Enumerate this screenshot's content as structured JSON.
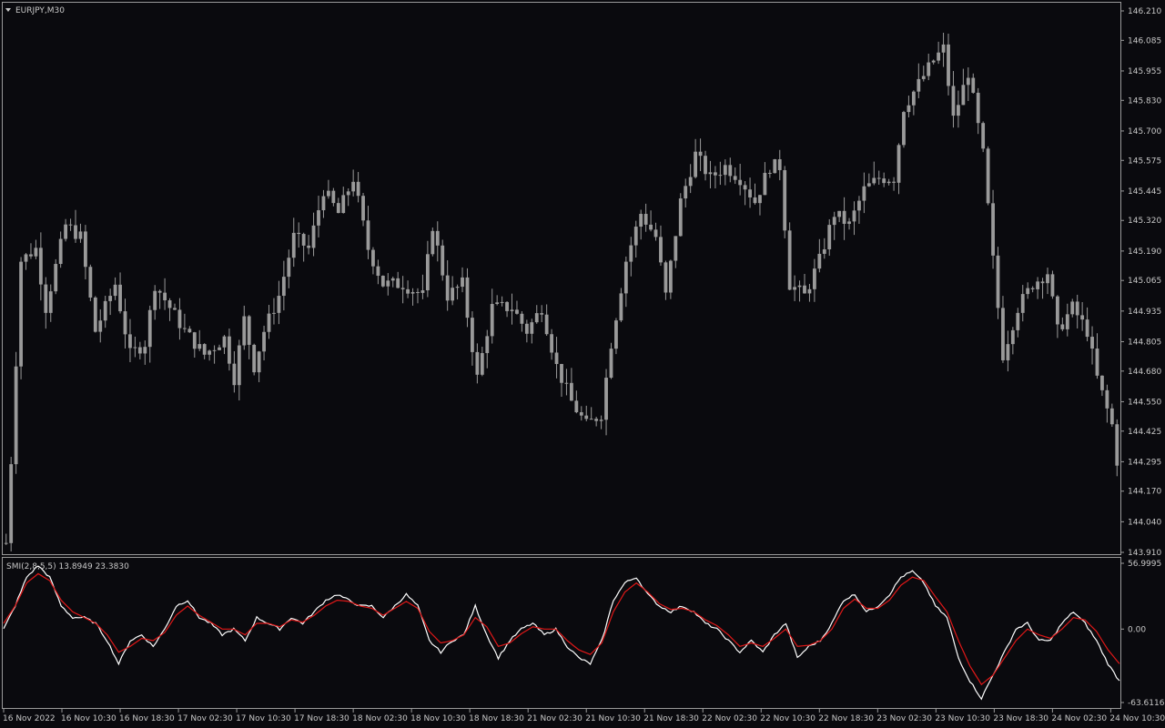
{
  "chart_title": "EURJPY,M30",
  "indicator_label": "SMI(2,8,5,5) 13.8949 23.3830",
  "colors": {
    "background": "#0a0a0e",
    "candle": "#9a9a9a",
    "frame": "#9a9a9a",
    "text": "#c8c8c8",
    "smi_line": "#ffffff",
    "signal_line": "#e01818"
  },
  "icons": {
    "collapse": "triangle-down-icon"
  },
  "chart_data": [
    {
      "type": "candlestick",
      "title": "EURJPY,M30",
      "price_ticks": [
        "146.210",
        "146.085",
        "145.955",
        "145.830",
        "145.700",
        "145.575",
        "145.445",
        "145.320",
        "145.190",
        "145.065",
        "144.935",
        "144.805",
        "144.680",
        "144.550",
        "144.425",
        "144.295",
        "144.170",
        "144.040",
        "143.910"
      ],
      "ylim": [
        143.91,
        146.21
      ],
      "x_ticks": [
        "16 Nov 2022",
        "16 Nov 10:30",
        "16 Nov 18:30",
        "17 Nov 02:30",
        "17 Nov 10:30",
        "17 Nov 18:30",
        "18 Nov 02:30",
        "18 Nov 10:30",
        "18 Nov 18:30",
        "21 Nov 02:30",
        "21 Nov 10:30",
        "21 Nov 18:30",
        "22 Nov 02:30",
        "22 Nov 10:30",
        "22 Nov 18:30",
        "23 Nov 02:30",
        "23 Nov 10:30",
        "23 Nov 18:30",
        "24 Nov 02:30",
        "24 Nov 10:30"
      ],
      "close_anchors": [
        [
          0,
          143.95
        ],
        [
          1,
          144.3
        ],
        [
          3,
          145.15
        ],
        [
          6,
          145.2
        ],
        [
          8,
          144.95
        ],
        [
          12,
          145.3
        ],
        [
          15,
          145.25
        ],
        [
          18,
          144.85
        ],
        [
          22,
          145.05
        ],
        [
          25,
          144.75
        ],
        [
          28,
          144.8
        ],
        [
          30,
          145.05
        ],
        [
          33,
          144.95
        ],
        [
          36,
          144.85
        ],
        [
          40,
          144.75
        ],
        [
          44,
          144.82
        ],
        [
          46,
          144.65
        ],
        [
          48,
          144.9
        ],
        [
          50,
          144.7
        ],
        [
          52,
          144.85
        ],
        [
          55,
          145.0
        ],
        [
          58,
          145.25
        ],
        [
          61,
          145.2
        ],
        [
          64,
          145.45
        ],
        [
          67,
          145.35
        ],
        [
          70,
          145.5
        ],
        [
          73,
          145.2
        ],
        [
          76,
          145.05
        ],
        [
          80,
          145.05
        ],
        [
          84,
          145.0
        ],
        [
          86,
          145.3
        ],
        [
          89,
          145.0
        ],
        [
          92,
          145.05
        ],
        [
          95,
          144.65
        ],
        [
          98,
          144.95
        ],
        [
          102,
          144.95
        ],
        [
          105,
          144.85
        ],
        [
          108,
          144.95
        ],
        [
          111,
          144.7
        ],
        [
          114,
          144.55
        ],
        [
          117,
          144.45
        ],
        [
          120,
          144.5
        ],
        [
          122,
          144.8
        ],
        [
          125,
          145.15
        ],
        [
          128,
          145.35
        ],
        [
          131,
          145.25
        ],
        [
          133,
          145.0
        ],
        [
          136,
          145.4
        ],
        [
          139,
          145.6
        ],
        [
          142,
          145.5
        ],
        [
          145,
          145.55
        ],
        [
          148,
          145.5
        ],
        [
          151,
          145.4
        ],
        [
          154,
          145.55
        ],
        [
          156,
          145.55
        ],
        [
          158,
          145.05
        ],
        [
          161,
          145.0
        ],
        [
          164,
          145.15
        ],
        [
          167,
          145.35
        ],
        [
          170,
          145.3
        ],
        [
          173,
          145.45
        ],
        [
          176,
          145.5
        ],
        [
          179,
          145.5
        ],
        [
          181,
          145.8
        ],
        [
          184,
          145.9
        ],
        [
          187,
          146.0
        ],
        [
          189,
          146.05
        ],
        [
          191,
          145.75
        ],
        [
          194,
          145.95
        ],
        [
          197,
          145.6
        ],
        [
          199,
          145.15
        ],
        [
          201,
          144.75
        ],
        [
          204,
          144.95
        ],
        [
          207,
          145.05
        ],
        [
          210,
          145.1
        ],
        [
          212,
          144.85
        ],
        [
          215,
          144.95
        ],
        [
          218,
          144.85
        ],
        [
          220,
          144.65
        ],
        [
          223,
          144.45
        ],
        [
          224,
          144.3
        ]
      ]
    },
    {
      "type": "line",
      "title": "SMI(2,8,5,5) 13.8949 23.3830",
      "value_ticks": [
        "56.9995",
        "0.00",
        "-63.6116"
      ],
      "ylim": [
        -63.6116,
        56.9995
      ],
      "series": [
        {
          "color": "#ffffff",
          "anchors": [
            [
              0,
              0
            ],
            [
              2,
              20
            ],
            [
              4,
              45
            ],
            [
              6,
              55
            ],
            [
              8,
              45
            ],
            [
              10,
              20
            ],
            [
              12,
              10
            ],
            [
              14,
              10
            ],
            [
              16,
              5
            ],
            [
              18,
              -10
            ],
            [
              20,
              -30
            ],
            [
              22,
              -10
            ],
            [
              24,
              -5
            ],
            [
              26,
              -15
            ],
            [
              28,
              0
            ],
            [
              30,
              20
            ],
            [
              32,
              25
            ],
            [
              34,
              10
            ],
            [
              36,
              5
            ],
            [
              38,
              -5
            ],
            [
              40,
              0
            ],
            [
              42,
              -10
            ],
            [
              44,
              10
            ],
            [
              46,
              5
            ],
            [
              48,
              0
            ],
            [
              50,
              10
            ],
            [
              52,
              5
            ],
            [
              54,
              15
            ],
            [
              56,
              25
            ],
            [
              58,
              30
            ],
            [
              60,
              25
            ],
            [
              62,
              20
            ],
            [
              64,
              20
            ],
            [
              66,
              10
            ],
            [
              68,
              20
            ],
            [
              70,
              30
            ],
            [
              72,
              20
            ],
            [
              74,
              -10
            ],
            [
              76,
              -20
            ],
            [
              78,
              -10
            ],
            [
              80,
              -5
            ],
            [
              82,
              20
            ],
            [
              84,
              -5
            ],
            [
              86,
              -25
            ],
            [
              88,
              -10
            ],
            [
              90,
              0
            ],
            [
              92,
              5
            ],
            [
              94,
              -5
            ],
            [
              96,
              0
            ],
            [
              98,
              -15
            ],
            [
              100,
              -25
            ],
            [
              102,
              -30
            ],
            [
              104,
              -10
            ],
            [
              106,
              25
            ],
            [
              108,
              40
            ],
            [
              110,
              45
            ],
            [
              112,
              30
            ],
            [
              114,
              20
            ],
            [
              116,
              15
            ],
            [
              118,
              20
            ],
            [
              120,
              15
            ],
            [
              122,
              5
            ],
            [
              124,
              0
            ],
            [
              126,
              -10
            ],
            [
              128,
              -20
            ],
            [
              130,
              -10
            ],
            [
              132,
              -20
            ],
            [
              134,
              -5
            ],
            [
              136,
              5
            ],
            [
              138,
              -25
            ],
            [
              140,
              -15
            ],
            [
              142,
              -10
            ],
            [
              144,
              5
            ],
            [
              146,
              25
            ],
            [
              148,
              30
            ],
            [
              150,
              15
            ],
            [
              152,
              20
            ],
            [
              154,
              30
            ],
            [
              156,
              45
            ],
            [
              158,
              50
            ],
            [
              160,
              40
            ],
            [
              162,
              20
            ],
            [
              164,
              10
            ],
            [
              166,
              -25
            ],
            [
              168,
              -45
            ],
            [
              170,
              -60
            ],
            [
              172,
              -40
            ],
            [
              174,
              -20
            ],
            [
              176,
              0
            ],
            [
              178,
              5
            ],
            [
              180,
              -10
            ],
            [
              182,
              -10
            ],
            [
              184,
              5
            ],
            [
              186,
              15
            ],
            [
              188,
              5
            ],
            [
              190,
              -10
            ],
            [
              192,
              -30
            ],
            [
              194,
              -45
            ]
          ]
        },
        {
          "color": "#e01818",
          "anchors": [
            [
              0,
              5
            ],
            [
              2,
              20
            ],
            [
              4,
              40
            ],
            [
              6,
              48
            ],
            [
              8,
              42
            ],
            [
              10,
              25
            ],
            [
              12,
              15
            ],
            [
              14,
              10
            ],
            [
              16,
              5
            ],
            [
              18,
              -5
            ],
            [
              20,
              -20
            ],
            [
              22,
              -15
            ],
            [
              24,
              -8
            ],
            [
              26,
              -10
            ],
            [
              28,
              -3
            ],
            [
              30,
              12
            ],
            [
              32,
              20
            ],
            [
              34,
              12
            ],
            [
              36,
              6
            ],
            [
              38,
              0
            ],
            [
              40,
              0
            ],
            [
              42,
              -5
            ],
            [
              44,
              5
            ],
            [
              46,
              5
            ],
            [
              48,
              2
            ],
            [
              50,
              8
            ],
            [
              52,
              6
            ],
            [
              54,
              12
            ],
            [
              56,
              20
            ],
            [
              58,
              25
            ],
            [
              60,
              24
            ],
            [
              62,
              20
            ],
            [
              64,
              18
            ],
            [
              66,
              12
            ],
            [
              68,
              18
            ],
            [
              70,
              24
            ],
            [
              72,
              18
            ],
            [
              74,
              -2
            ],
            [
              76,
              -12
            ],
            [
              78,
              -10
            ],
            [
              80,
              -5
            ],
            [
              82,
              10
            ],
            [
              84,
              2
            ],
            [
              86,
              -15
            ],
            [
              88,
              -12
            ],
            [
              90,
              -4
            ],
            [
              92,
              2
            ],
            [
              94,
              0
            ],
            [
              96,
              0
            ],
            [
              98,
              -10
            ],
            [
              100,
              -18
            ],
            [
              102,
              -22
            ],
            [
              104,
              -12
            ],
            [
              106,
              15
            ],
            [
              108,
              32
            ],
            [
              110,
              40
            ],
            [
              112,
              32
            ],
            [
              114,
              22
            ],
            [
              116,
              17
            ],
            [
              118,
              18
            ],
            [
              120,
              15
            ],
            [
              122,
              8
            ],
            [
              124,
              3
            ],
            [
              126,
              -5
            ],
            [
              128,
              -15
            ],
            [
              130,
              -12
            ],
            [
              132,
              -15
            ],
            [
              134,
              -8
            ],
            [
              136,
              0
            ],
            [
              138,
              -15
            ],
            [
              140,
              -14
            ],
            [
              142,
              -10
            ],
            [
              144,
              0
            ],
            [
              146,
              18
            ],
            [
              148,
              26
            ],
            [
              150,
              18
            ],
            [
              152,
              18
            ],
            [
              154,
              25
            ],
            [
              156,
              38
            ],
            [
              158,
              45
            ],
            [
              160,
              42
            ],
            [
              162,
              28
            ],
            [
              164,
              15
            ],
            [
              166,
              -10
            ],
            [
              168,
              -32
            ],
            [
              170,
              -48
            ],
            [
              172,
              -40
            ],
            [
              174,
              -25
            ],
            [
              176,
              -10
            ],
            [
              178,
              0
            ],
            [
              180,
              -5
            ],
            [
              182,
              -8
            ],
            [
              184,
              0
            ],
            [
              186,
              10
            ],
            [
              188,
              8
            ],
            [
              190,
              -2
            ],
            [
              192,
              -18
            ],
            [
              194,
              -30
            ]
          ]
        }
      ]
    }
  ]
}
